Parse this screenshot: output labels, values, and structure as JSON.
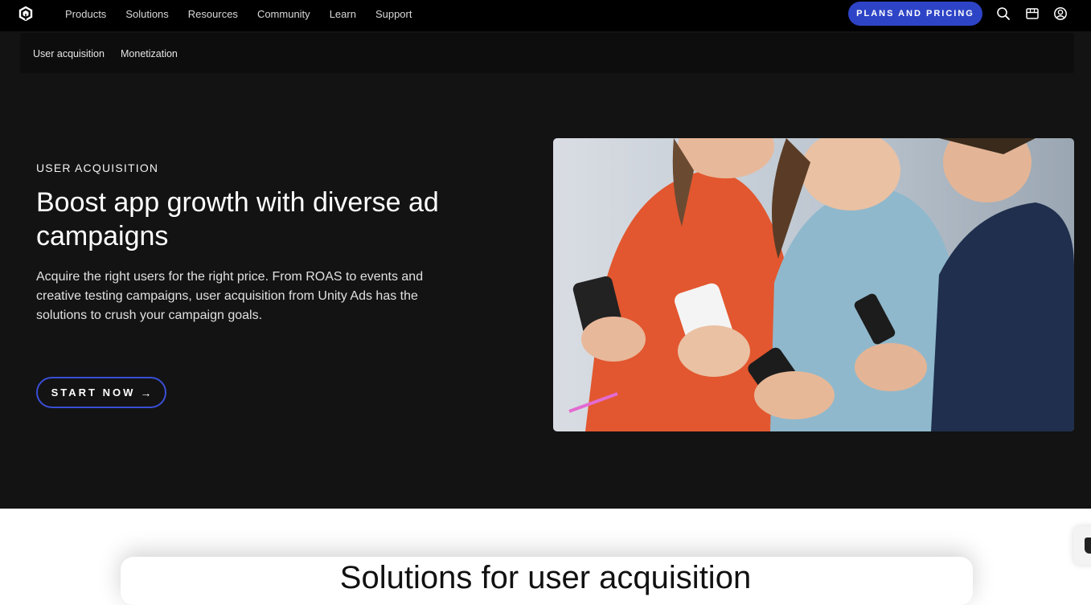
{
  "nav": {
    "items": [
      {
        "label": "Products"
      },
      {
        "label": "Solutions"
      },
      {
        "label": "Resources"
      },
      {
        "label": "Community"
      },
      {
        "label": "Learn"
      },
      {
        "label": "Support"
      }
    ],
    "cta_label": "PLANS AND PRICING",
    "icons": [
      "unity-logo-icon",
      "search-icon",
      "store-icon",
      "account-icon"
    ]
  },
  "subnav": {
    "items": [
      {
        "label": "User acquisition"
      },
      {
        "label": "Monetization"
      }
    ]
  },
  "hero": {
    "eyebrow": "USER ACQUISITION",
    "headline": "Boost app growth with diverse ad campaigns",
    "description": "Acquire the right users for the right price. From ROAS to events and creative testing campaigns, user acquisition from Unity Ads has the solutions to crush your campaign goals.",
    "cta_label": "START NOW",
    "cta_icon": "arrow-right-icon",
    "image_alt": "Three people smiling and using smartphones"
  },
  "solutions": {
    "title": "Solutions for user acquisition"
  },
  "colors": {
    "nav_bg": "#000000",
    "hero_bg": "#131313",
    "accent": "#2e44c7",
    "text_light": "#ffffff"
  }
}
